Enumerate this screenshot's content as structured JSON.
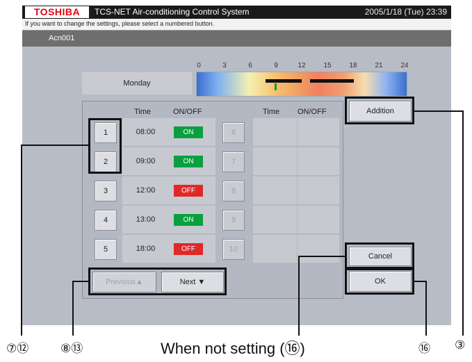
{
  "header": {
    "logo": "TOSHIBA",
    "app_title": "TCS-NET Air-conditioning Control System",
    "datetime": "2005/1/18 (Tue)  23:39"
  },
  "message": "If you want to change the settings, please select a numbered button.",
  "unit_name": "Acn001",
  "timeline": {
    "day": "Monday",
    "scale": [
      "0",
      "3",
      "6",
      "9",
      "12",
      "15",
      "18",
      "21",
      "24"
    ]
  },
  "table": {
    "headers": {
      "time": "Time",
      "onoff": "ON/OFF"
    },
    "left_rows": [
      {
        "num": "1",
        "time": "08:00",
        "state": "ON"
      },
      {
        "num": "2",
        "time": "09:00",
        "state": "ON"
      },
      {
        "num": "3",
        "time": "12:00",
        "state": "OFF"
      },
      {
        "num": "4",
        "time": "13:00",
        "state": "ON"
      },
      {
        "num": "5",
        "time": "18:00",
        "state": "OFF"
      }
    ],
    "right_rows": [
      {
        "num": "6"
      },
      {
        "num": "7"
      },
      {
        "num": "8"
      },
      {
        "num": "9"
      },
      {
        "num": "10"
      }
    ]
  },
  "buttons": {
    "addition": "Addition",
    "cancel": "Cancel",
    "ok": "OK",
    "previous": "Previous▲",
    "next": "Next ▼"
  },
  "annotations": {
    "c7_12": "⑦⑫",
    "c8_13": "⑧⑬",
    "not_setting": "When not setting (⑯)",
    "c16": "⑯",
    "c3": "③"
  },
  "colors": {
    "on": "#0aa040",
    "off": "#e02828"
  }
}
